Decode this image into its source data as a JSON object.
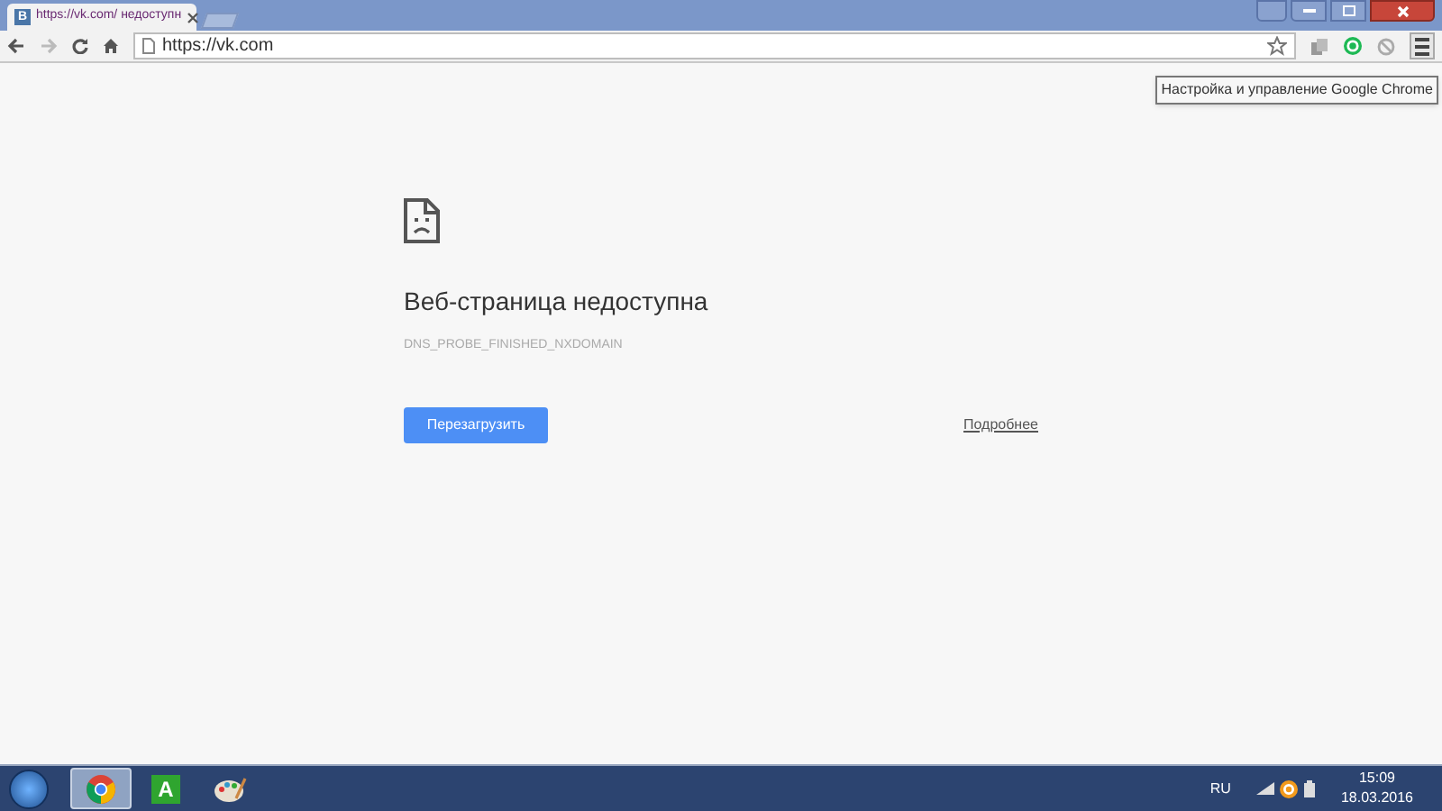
{
  "browser": {
    "tabs": [
      {
        "favicon": "В",
        "title": "https://vk.com/ недоступн",
        "selected": true
      }
    ],
    "address": "https://vk.com",
    "tooltip": "Настройка и управление Google Chrome"
  },
  "error_page": {
    "title": "Веб-страница недоступна",
    "code": "DNS_PROBE_FINISHED_NXDOMAIN",
    "reload_button": "Перезагрузить",
    "details_link": "Подробнее"
  },
  "taskbar": {
    "apps": [
      {
        "kind": "chrome",
        "selected": true
      },
      {
        "kind": "letter",
        "label": "A",
        "selected": false
      },
      {
        "kind": "paint",
        "selected": false
      }
    ],
    "language": "RU",
    "time": "15:09",
    "date": "18.03.2016"
  }
}
